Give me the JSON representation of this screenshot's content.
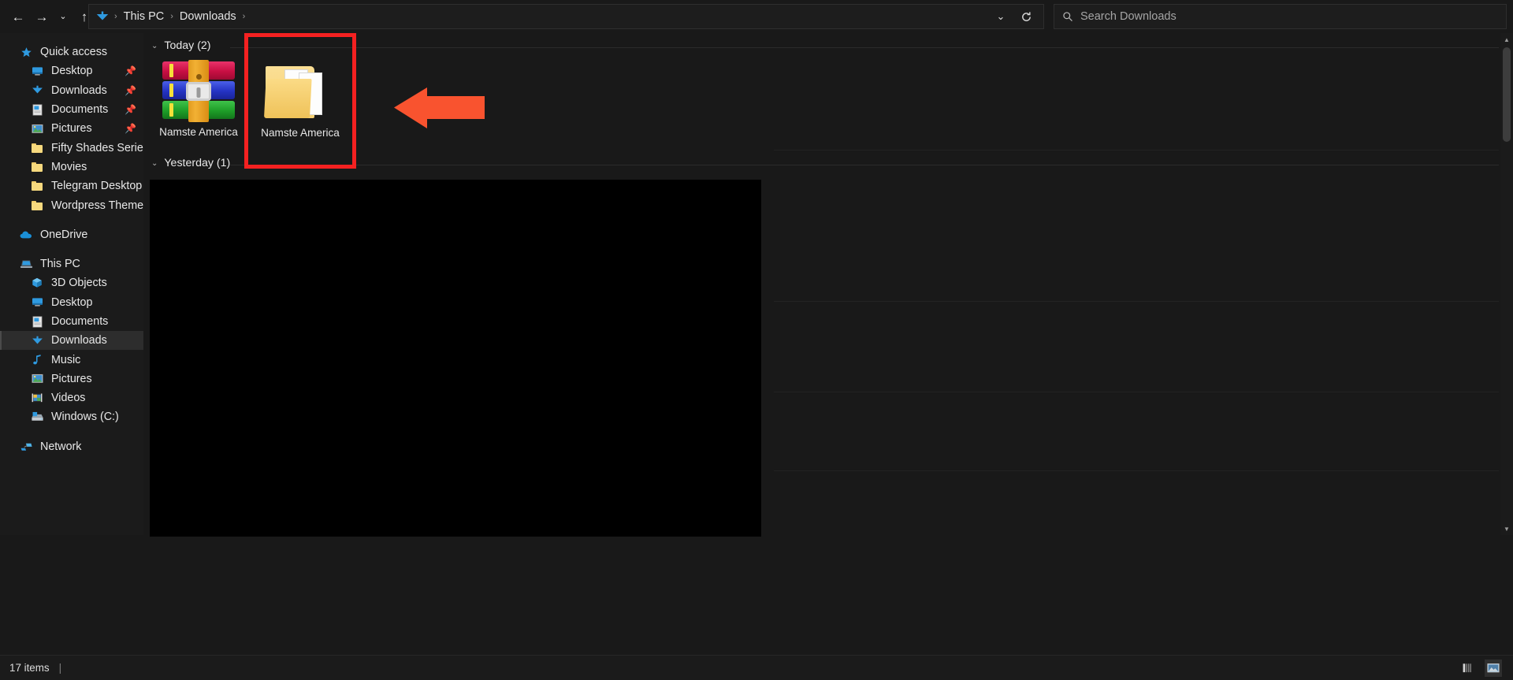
{
  "window": {
    "title": "Downloads"
  },
  "toolbar": {
    "back_icon": "←",
    "forward_icon": "→",
    "recent_icon": "⌄",
    "up_icon": "↑",
    "breadcrumb": {
      "location_icon": "downloads-arrow-icon",
      "items": [
        "This PC",
        "Downloads"
      ],
      "separator": "›"
    },
    "address_dropdown_icon": "⌄",
    "refresh_icon": "↻",
    "search": {
      "icon": "search-icon",
      "placeholder": "Search Downloads"
    }
  },
  "sidebar": {
    "quick_access": {
      "label": "Quick access",
      "icon": "star-icon",
      "items": [
        {
          "label": "Desktop",
          "icon": "desktop-icon",
          "pinned": true
        },
        {
          "label": "Downloads",
          "icon": "downloads-icon",
          "pinned": true
        },
        {
          "label": "Documents",
          "icon": "documents-icon",
          "pinned": true
        },
        {
          "label": "Pictures",
          "icon": "pictures-icon",
          "pinned": true
        },
        {
          "label": "Fifty Shades Series",
          "icon": "folder-icon",
          "pinned": false
        },
        {
          "label": "Movies",
          "icon": "folder-icon",
          "pinned": false
        },
        {
          "label": "Telegram Desktop",
          "icon": "folder-icon",
          "pinned": false
        },
        {
          "label": "Wordpress Themes",
          "icon": "folder-icon",
          "pinned": false
        }
      ]
    },
    "onedrive": {
      "label": "OneDrive",
      "icon": "cloud-icon"
    },
    "this_pc": {
      "label": "This PC",
      "icon": "computer-icon",
      "items": [
        {
          "label": "3D Objects",
          "icon": "3d-objects-icon",
          "selected": false
        },
        {
          "label": "Desktop",
          "icon": "desktop-icon",
          "selected": false
        },
        {
          "label": "Documents",
          "icon": "documents-icon",
          "selected": false
        },
        {
          "label": "Downloads",
          "icon": "downloads-icon",
          "selected": true
        },
        {
          "label": "Music",
          "icon": "music-icon",
          "selected": false
        },
        {
          "label": "Pictures",
          "icon": "pictures-icon",
          "selected": false
        },
        {
          "label": "Videos",
          "icon": "videos-icon",
          "selected": false
        },
        {
          "label": "Windows (C:)",
          "icon": "drive-icon",
          "selected": false
        }
      ]
    },
    "network": {
      "label": "Network",
      "icon": "network-icon"
    }
  },
  "content": {
    "groups": [
      {
        "label": "Today (2)",
        "chevron": "⌄"
      },
      {
        "label": "Yesterday (1)",
        "chevron": "⌄"
      }
    ],
    "items": [
      {
        "label": "Namste America",
        "icon": "winrar-archive-icon",
        "selected": false
      },
      {
        "label": "Namste America",
        "icon": "folder-with-documents-icon",
        "selected": false
      }
    ]
  },
  "annotations": {
    "highlight_color": "#f42121",
    "arrow_color": "#f9532f",
    "highlight_target": "Namste America",
    "arrow_direction": "left"
  },
  "statusbar": {
    "item_count": "17 items",
    "separator": "|",
    "view_details_icon": "details-view-icon",
    "view_thumbnails_icon": "thumbnails-view-icon"
  },
  "scrollbar": {
    "up_icon": "▲",
    "down_icon": "▼"
  }
}
